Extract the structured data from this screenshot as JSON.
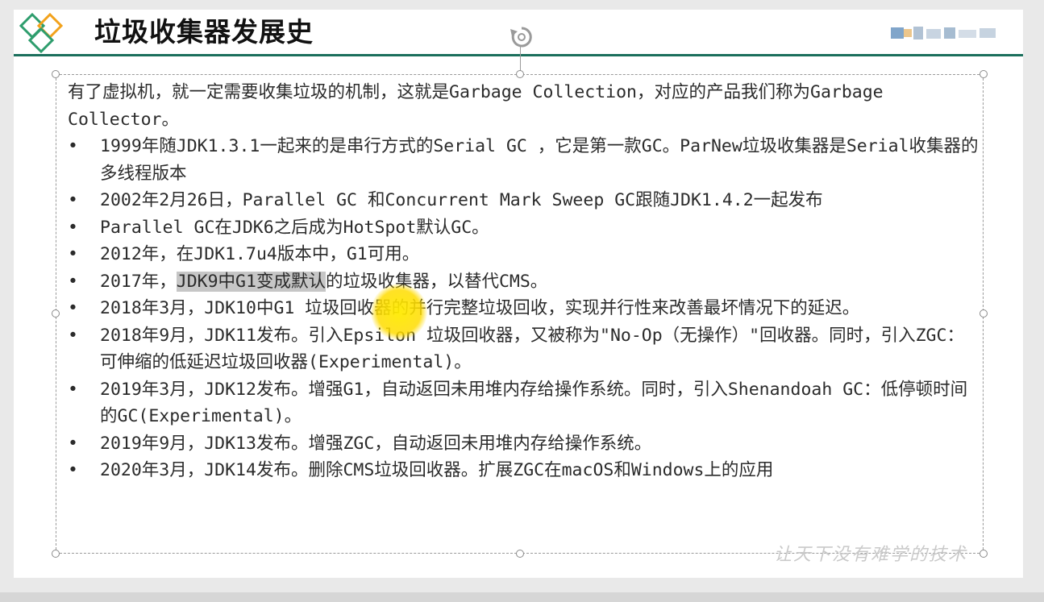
{
  "slide": {
    "title": "垃圾收集器发展史",
    "accent_color": "#1b6f5c",
    "logo_icon": "diamond-logo-icon",
    "brand_logo_icon": "blurred-brand-logo-icon"
  },
  "content": {
    "intro": "有了虚拟机，就一定需要收集垃圾的机制，这就是Garbage Collection，对应的产品我们称为Garbage Collector。",
    "bullet_symbol": "•",
    "bullets": [
      "1999年随JDK1.3.1一起来的是串行方式的Serial GC ，它是第一款GC。ParNew垃圾收集器是Serial收集器的多线程版本",
      "2002年2月26日，Parallel GC 和Concurrent Mark Sweep GC跟随JDK1.4.2一起发布",
      "Parallel GC在JDK6之后成为HotSpot默认GC。",
      "2012年，在JDK1.7u4版本中，G1可用。",
      {
        "before": "2017年，",
        "highlight": "JDK9中G1变成默认",
        "after": "的垃圾收集器，以替代CMS。"
      },
      "2018年3月，JDK10中G1 垃圾回收器的并行完整垃圾回收，实现并行性来改善最坏情况下的延迟。",
      "2018年9月，JDK11发布。引入Epsilon 垃圾回收器，又被称为\"No-Op（无操作）\"回收器。同时，引入ZGC：可伸缩的低延迟垃圾回收器(Experimental)。",
      "2019年3月，JDK12发布。增强G1，自动返回未用堆内存给操作系统。同时，引入Shenandoah GC：低停顿时间的GC(Experimental)。",
      "2019年9月，JDK13发布。增强ZGC，自动返回未用堆内存给操作系统。",
      "2020年3月，JDK14发布。删除CMS垃圾回收器。扩展ZGC在macOS和Windows上的应用"
    ]
  },
  "watermark": "让天下没有难学的技术",
  "highlight_color": "#c6c6c6"
}
